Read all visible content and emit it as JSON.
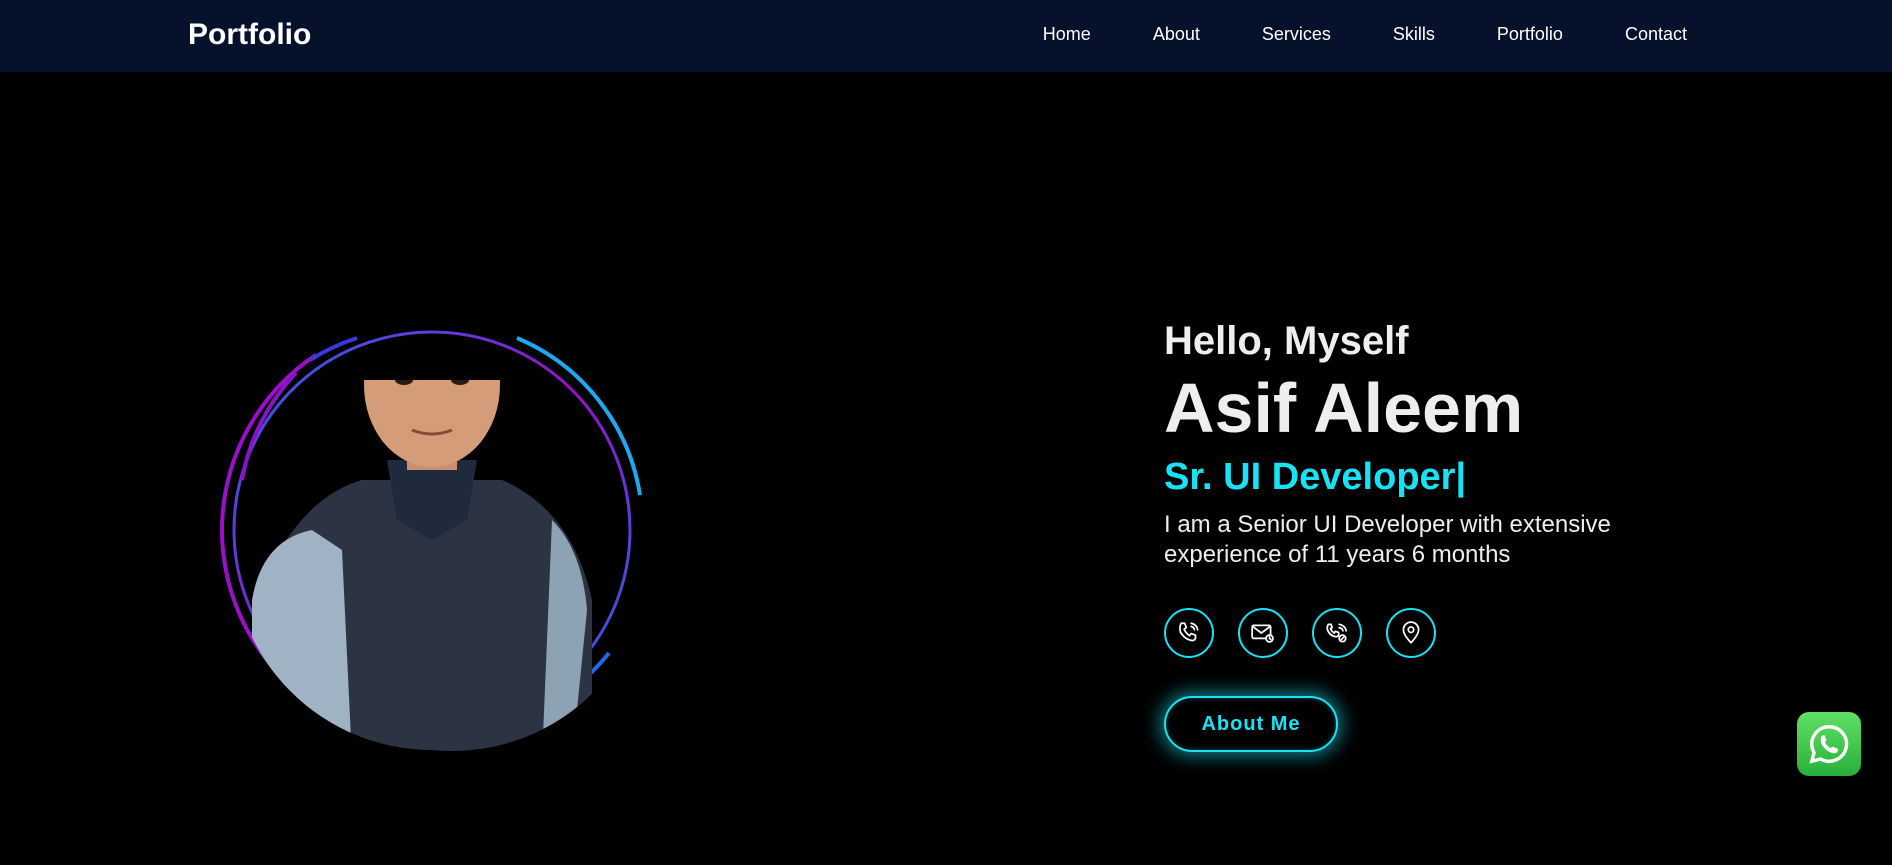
{
  "header": {
    "brand": "Portfolio",
    "nav": [
      {
        "label": "Home"
      },
      {
        "label": "About"
      },
      {
        "label": "Services"
      },
      {
        "label": "Skills"
      },
      {
        "label": "Portfolio"
      },
      {
        "label": "Contact"
      }
    ]
  },
  "hero": {
    "greeting": "Hello, Myself",
    "name": "Asif Aleem",
    "role": "Sr. UI Developer|",
    "bio": "I am a Senior UI Developer with extensive experience of 11 years 6 months",
    "contact_icons": [
      "phone-icon",
      "email-icon",
      "wifi-call-icon",
      "location-icon"
    ],
    "button_label": "About Me"
  },
  "colors": {
    "accent": "#18e2f5",
    "navbar_bg": "#06112b",
    "background": "#000000",
    "ring_purple": "#9a10c8",
    "ring_blue": "#1e6be8",
    "whatsapp": "#2fb440"
  }
}
